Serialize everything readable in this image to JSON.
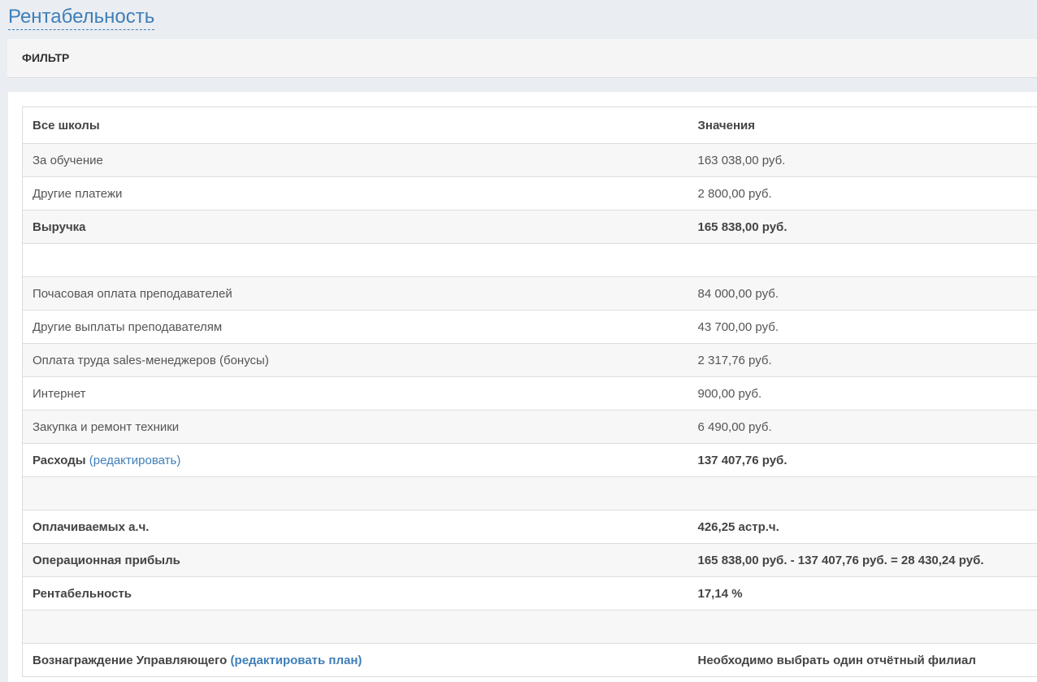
{
  "page": {
    "title": "Рентабельность"
  },
  "filter": {
    "label": "ФИЛЬТР"
  },
  "table": {
    "headers": [
      "Все школы",
      "Значения"
    ],
    "rows": [
      {
        "label": "За обучение",
        "value": "163 038,00 руб."
      },
      {
        "label": "Другие платежи",
        "value": "2 800,00 руб."
      },
      {
        "label": "Выручка",
        "value": "165 838,00 руб."
      },
      {
        "label": "",
        "value": ""
      },
      {
        "label": "Почасовая оплата преподавателей",
        "value": "84 000,00 руб."
      },
      {
        "label": "Другие выплаты преподавателям",
        "value": "43 700,00 руб."
      },
      {
        "label": "Оплата труда sales-менеджеров (бонусы)",
        "value": "2 317,76 руб."
      },
      {
        "label": "Интернет",
        "value": "900,00 руб."
      },
      {
        "label": "Закупка и ремонт техники",
        "value": "6 490,00 руб."
      },
      {
        "label": "Расходы",
        "link": "(редактировать)",
        "value": "137 407,76 руб."
      },
      {
        "label": "",
        "value": ""
      },
      {
        "label": "Оплачиваемых а.ч.",
        "value": "426,25 астр.ч."
      },
      {
        "label": "Операционная прибыль",
        "value": "165 838,00 руб. - 137 407,76 руб. = 28 430,24 руб."
      },
      {
        "label": "Рентабельность",
        "value": "17,14 %"
      },
      {
        "label": "",
        "value": ""
      },
      {
        "label": "Вознаграждение Управляющего",
        "link": "(редактировать план)",
        "value": "Необходимо выбрать один отчётный филиал"
      }
    ]
  }
}
